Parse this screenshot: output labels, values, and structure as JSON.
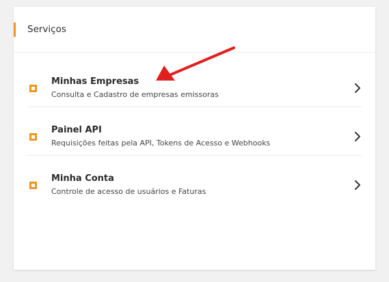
{
  "card": {
    "title": "Serviços"
  },
  "items": [
    {
      "title": "Minhas Empresas",
      "subtitle": "Consulta e Cadastro de empresas emissoras"
    },
    {
      "title": "Painel API",
      "subtitle": "Requisições feitas pela API, Tokens de Acesso e Webhooks"
    },
    {
      "title": "Minha Conta",
      "subtitle": "Controle de acesso de usuários e Faturas"
    }
  ],
  "icons": {
    "item_icon": "square-outline-icon",
    "chevron": "chevron-right-icon",
    "annotation": "red-arrow-annotation"
  },
  "colors": {
    "accent": "#f0941f",
    "annotation_red": "#e02020"
  }
}
